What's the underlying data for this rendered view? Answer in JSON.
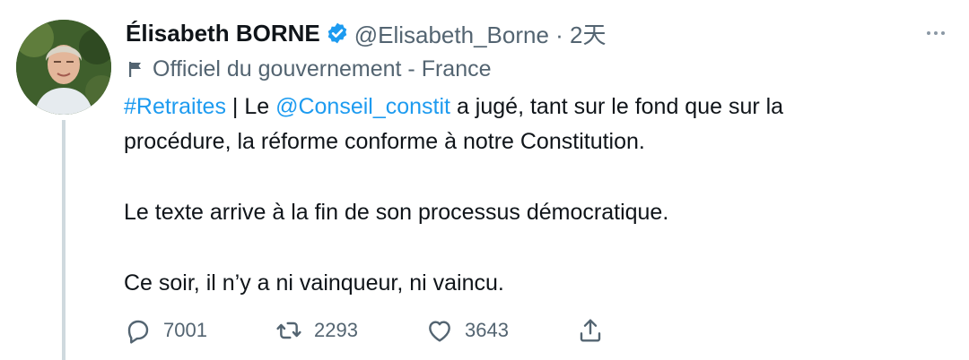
{
  "tweet": {
    "author_name": "Élisabeth BORNE",
    "handle_time": "@Elisabeth_Borne · 2天",
    "affiliation": "Officiel du gouvernement - France",
    "line1_hashtag": "#Retraites",
    "line1_sep": " | Le ",
    "line1_mention": "@Conseil_constit",
    "line1_rest": " a jugé, tant sur le fond que sur la",
    "line2": "procédure, la réforme conforme à notre Constitution.",
    "paragraph2": "Le texte arrive à la fin de son processus démocratique.",
    "paragraph3": "Ce soir, il n’y a ni vainqueur, ni vaincu.",
    "replies": "7001",
    "retweets": "2293",
    "likes": "3643"
  },
  "icons": {
    "verified": "verified-badge-icon",
    "more": "more-dots-icon",
    "flag": "flag-icon",
    "reply": "reply-icon",
    "retweet": "retweet-icon",
    "like": "heart-icon",
    "share": "share-icon"
  },
  "colors": {
    "accent": "#1d9bf0",
    "text": "#0f1419",
    "muted": "#536471"
  }
}
